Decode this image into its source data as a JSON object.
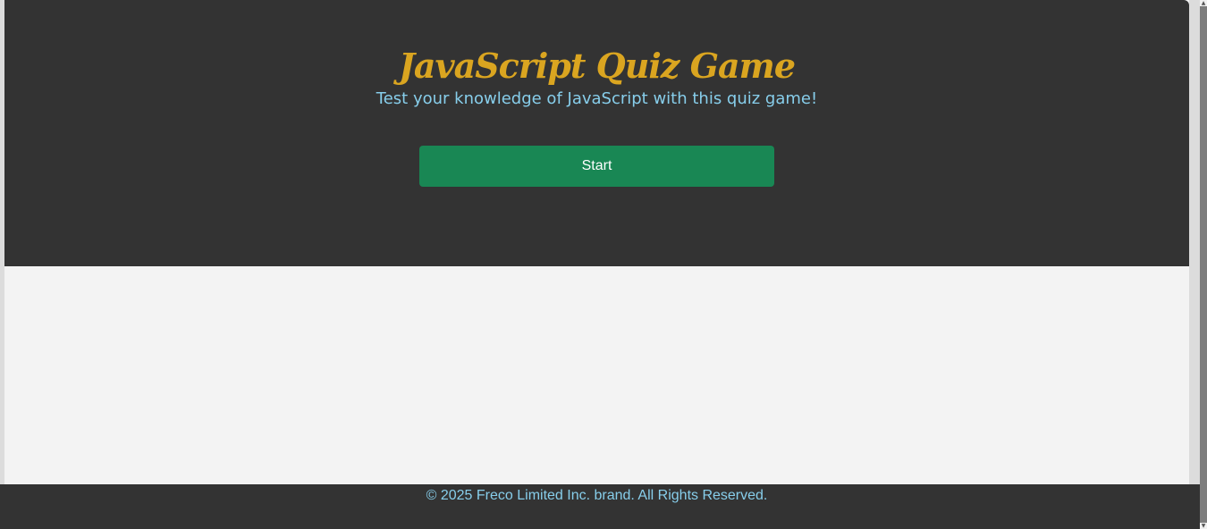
{
  "header": {
    "title": "JavaScript Quiz Game",
    "subtitle": "Test your knowledge of JavaScript with this quiz game!"
  },
  "actions": {
    "start_label": "Start"
  },
  "footer": {
    "copyright": "© 2025 Freco Limited Inc. brand. All Rights Reserved."
  },
  "scrollbar": {
    "up_icon": "chevron-up-icon",
    "down_icon": "chevron-down-icon"
  },
  "colors": {
    "hero_background": "#333333",
    "title": "#daa520",
    "subtitle": "#87ceeb",
    "start_button": "#198754",
    "page_background": "#f3f3f3",
    "footer_text": "#87ceeb"
  }
}
